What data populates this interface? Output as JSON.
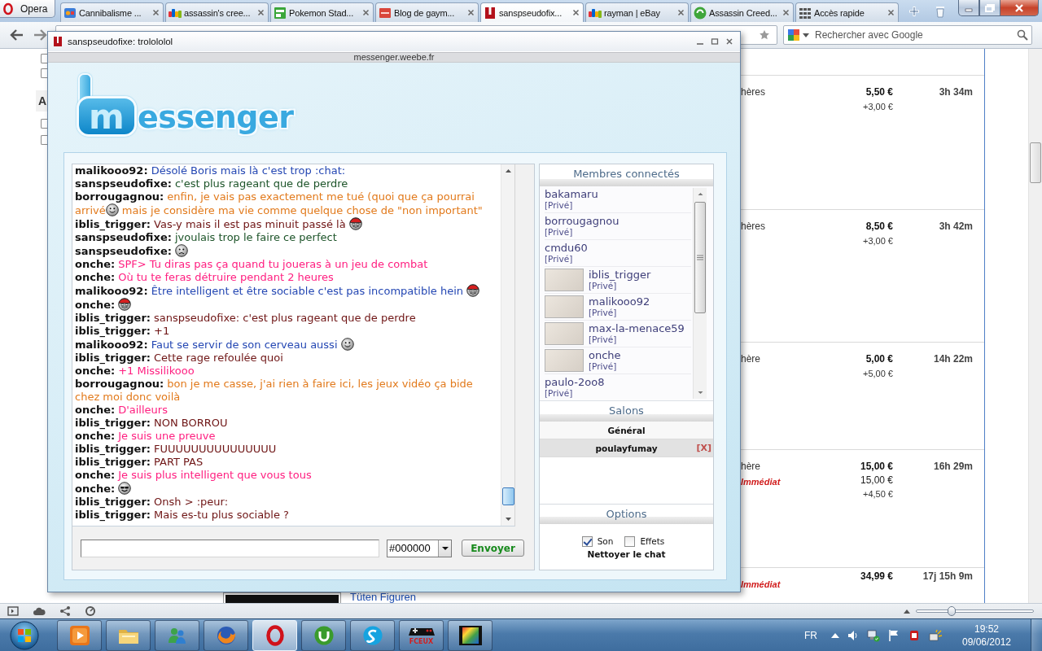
{
  "browser": {
    "menu_button": "Opera",
    "tabs": [
      {
        "title": "Cannibalisme ...",
        "selected": false
      },
      {
        "title": "assassin's cree...",
        "selected": false
      },
      {
        "title": "Pokemon Stad...",
        "selected": false
      },
      {
        "title": "Blog de gaym...",
        "selected": false
      },
      {
        "title": "sanspseudofix...",
        "selected": true
      },
      {
        "title": "rayman | eBay",
        "selected": false
      },
      {
        "title": "Assassin Creed...",
        "selected": false
      },
      {
        "title": "Accès rapide",
        "selected": false
      }
    ],
    "search": {
      "placeholder": "Rechercher avec Google"
    },
    "zoom": {
      "level": 0.3
    }
  },
  "page": {
    "filters": [
      {
        "kind": "checkbox",
        "checked": false
      },
      {
        "kind": "checkbox",
        "checked": false
      },
      {
        "kind": "heading",
        "text": "A"
      },
      {
        "kind": "checkbox",
        "checked": false
      },
      {
        "kind": "checkbox",
        "checked": false
      }
    ],
    "listings": [
      {
        "title_end": "hères",
        "price": "5,50 €",
        "shipping": "+3,00 €",
        "time_left": "3h 34m"
      },
      {
        "title_end": "hères",
        "price": "8,50 €",
        "shipping": "+3,00 €",
        "time_left": "3h 42m"
      },
      {
        "title_end": "hère",
        "price": "5,00 €",
        "shipping": "+5,00 €",
        "time_left": "14h 22m"
      },
      {
        "title_end": "hère",
        "format": "Immédiat",
        "price": "15,00 €",
        "buy_now_price": "15,00 €",
        "shipping": "+4,50 €",
        "time_left": "16h 29m"
      },
      {
        "photo": true,
        "title": "Tüten Figuren",
        "format": "Immédiat",
        "price": "34,99 €",
        "time_left": "17j 15h 9m"
      }
    ]
  },
  "popup": {
    "title": "sanspseudofixe: trolololol",
    "address": "messenger.weebe.fr",
    "logo": {
      "boxed": "m",
      "rest": "essenger"
    },
    "chat": {
      "messages": [
        {
          "author": "malikooo92:",
          "color": "#2447b3",
          "parts": [
            {
              "kind": "text",
              "text": "Désolé Boris mais là c'est trop :chat:"
            }
          ]
        },
        {
          "author": "sanspseudofixe:",
          "color": "#1d5429",
          "parts": [
            {
              "kind": "text",
              "text": "c'est plus rageant que de perdre"
            }
          ]
        },
        {
          "author": "borrougagnou:",
          "color": "#e27a1c",
          "parts": [
            {
              "kind": "text",
              "text": "enfin, je vais pas exactement me tué (quoi que ça pourrai"
            }
          ],
          "continued": [
            {
              "kind": "text",
              "text": "arrivé"
            },
            {
              "kind": "grin"
            },
            {
              "kind": "text",
              "text": " mais je considère ma vie comme quelque chose de \"non important\""
            }
          ]
        },
        {
          "author": "iblis_trigger:",
          "color": "#6e1414",
          "parts": [
            {
              "kind": "text",
              "text": "Vas-y mais il est pas minuit passé là "
            },
            {
              "kind": "cap"
            }
          ]
        },
        {
          "author": "sanspseudofixe:",
          "color": "#1d5429",
          "parts": [
            {
              "kind": "text",
              "text": "jvoulais trop le faire ce perfect"
            }
          ]
        },
        {
          "author": "sanspseudofixe:",
          "parts": [
            {
              "kind": "frown"
            }
          ]
        },
        {
          "author": "onche:",
          "color": "#ff1f80",
          "parts": [
            {
              "kind": "text",
              "text": "SPF> Tu diras pas ça quand tu joueras à un jeu de combat"
            }
          ]
        },
        {
          "author": "onche:",
          "color": "#ff1f80",
          "parts": [
            {
              "kind": "text",
              "text": "Où tu te feras détruire pendant 2 heures"
            }
          ]
        },
        {
          "author": "malikooo92:",
          "color": "#2447b3",
          "parts": [
            {
              "kind": "text",
              "text": "Être intelligent et être sociable c'est pas incompatible hein "
            },
            {
              "kind": "cap"
            }
          ]
        },
        {
          "author": "onche:",
          "parts": [
            {
              "kind": "cap"
            }
          ]
        },
        {
          "author": "iblis_trigger:",
          "color": "#6e1414",
          "parts": [
            {
              "kind": "text",
              "text": "sanspseudofixe: c'est plus rageant que de perdre"
            }
          ]
        },
        {
          "author": "iblis_trigger:",
          "color": "#6e1414",
          "parts": [
            {
              "kind": "text",
              "text": "+1"
            }
          ]
        },
        {
          "author": "malikooo92:",
          "color": "#2447b3",
          "parts": [
            {
              "kind": "text",
              "text": "Faut se servir de son cerveau aussi "
            },
            {
              "kind": "grin"
            }
          ]
        },
        {
          "author": "iblis_trigger:",
          "color": "#6e1414",
          "parts": [
            {
              "kind": "text",
              "text": "Cette rage refoulée quoi"
            }
          ]
        },
        {
          "author": "onche:",
          "color": "#ff1f80",
          "parts": [
            {
              "kind": "text",
              "text": "+1 Missilikooo"
            }
          ]
        },
        {
          "author": "borrougagnou:",
          "color": "#e27a1c",
          "parts": [
            {
              "kind": "text",
              "text": "bon je me casse, j'ai rien à faire ici, les jeux vidéo ça bide"
            }
          ],
          "continued": [
            {
              "kind": "text",
              "text": "chez moi donc voilà"
            }
          ]
        },
        {
          "author": "onche:",
          "color": "#ff1f80",
          "parts": [
            {
              "kind": "text",
              "text": "D'ailleurs"
            }
          ]
        },
        {
          "author": "iblis_trigger:",
          "color": "#6e1414",
          "parts": [
            {
              "kind": "text",
              "text": "NON BORROU"
            }
          ]
        },
        {
          "author": "onche:",
          "color": "#ff1f80",
          "parts": [
            {
              "kind": "text",
              "text": "Je suis une preuve"
            }
          ]
        },
        {
          "author": "iblis_trigger:",
          "color": "#6e1414",
          "parts": [
            {
              "kind": "text",
              "text": "FUUUUUUUUUUUUUUU"
            }
          ]
        },
        {
          "author": "iblis_trigger:",
          "color": "#6e1414",
          "parts": [
            {
              "kind": "text",
              "text": "PART PAS"
            }
          ]
        },
        {
          "author": "onche:",
          "color": "#ff1f80",
          "parts": [
            {
              "kind": "text",
              "text": "Je suis plus intelligent que vous tous"
            }
          ]
        },
        {
          "author": "onche:",
          "parts": [
            {
              "kind": "shades"
            }
          ]
        },
        {
          "author": "iblis_trigger:",
          "color": "#6e1414",
          "parts": [
            {
              "kind": "text",
              "text": "Onsh > :peur:"
            }
          ]
        },
        {
          "author": "iblis_trigger:",
          "color": "#6e1414",
          "parts": [
            {
              "kind": "text",
              "text": "Mais es-tu plus sociable ?"
            }
          ]
        }
      ]
    },
    "composer": {
      "color_value": "#000000",
      "send": "Envoyer"
    },
    "members": {
      "title": "Membres connectés",
      "items": [
        {
          "name": "bakamaru",
          "private": "[Privé]",
          "avatar": false
        },
        {
          "name": "borrougagnou",
          "private": "[Privé]",
          "avatar": false
        },
        {
          "name": "cmdu60",
          "private": "[Privé]",
          "avatar": false
        },
        {
          "name": "iblis_trigger",
          "private": "[Privé]",
          "avatar": true
        },
        {
          "name": "malikooo92",
          "private": "[Privé]",
          "avatar": true
        },
        {
          "name": "max-la-menace59",
          "private": "[Privé]",
          "avatar": true
        },
        {
          "name": "onche",
          "private": "[Privé]",
          "avatar": true
        },
        {
          "name": "paulo-2oo8",
          "private": "[Privé]",
          "avatar": false
        }
      ]
    },
    "rooms": {
      "title": "Salons",
      "items": [
        {
          "name": "Général",
          "selected": false
        },
        {
          "name": "poulayfumay",
          "selected": true,
          "close": "[X]"
        }
      ]
    },
    "options": {
      "title": "Options",
      "toggles": [
        {
          "label": "Son",
          "checked": true
        },
        {
          "label": "Effets",
          "checked": false
        }
      ],
      "clear": "Nettoyer le chat"
    }
  },
  "taskbar": {
    "apps": [
      {
        "active": false
      },
      {
        "active": false
      },
      {
        "active": false
      },
      {
        "active": false
      },
      {
        "active": true
      },
      {
        "active": false
      },
      {
        "active": false
      },
      {
        "label": "FCEUX",
        "active": false
      },
      {
        "active": false
      }
    ],
    "language": "FR",
    "time": "19:52",
    "date": "09/06/2012"
  }
}
